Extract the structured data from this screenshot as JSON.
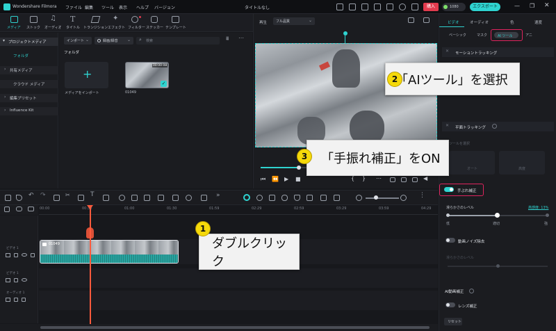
{
  "titlebar": {
    "app_name": "Wondershare Filmora",
    "menus": [
      "ファイル",
      "編集",
      "ツール",
      "表示",
      "ヘルプ",
      "バージョン"
    ],
    "doc_title": "タイトルなし",
    "buy_label": "購入",
    "points": "1080",
    "export_label": "エクスポート"
  },
  "toolbar_tabs": [
    "メディア",
    "ストック",
    "オーディオ",
    "タイトル",
    "トランジション",
    "エフェクト",
    "フィルター",
    "ステッカー",
    "テンプレート"
  ],
  "sidebar": {
    "items": [
      "プロジェクトメディア",
      "フォルダ",
      "共有メディア",
      "クラウド メディア",
      "編集プリセット",
      "Influence Kit"
    ]
  },
  "media": {
    "import_label": "インポート",
    "record_label": "録画/録音",
    "search_placeholder": "検索",
    "folder_label": "フォルダ",
    "import_tile_label": "メディアをインポート",
    "clip_name": "01049",
    "clip_duration": "00:00:08"
  },
  "player": {
    "play_label": "再生",
    "quality": "フル品質"
  },
  "right_panel": {
    "main_tabs": [
      "ビデオ",
      "オーディオ",
      "色",
      "速度"
    ],
    "sub_tabs": [
      "ベーシック",
      "マスク",
      "AI ツール",
      "アニ"
    ],
    "motion_tracking": "モーショントラッキング",
    "plane_tracking": "平面トラッキング",
    "auto_label": "オート",
    "enhanced_label": "高度",
    "auto_select_label": "ツールを選択",
    "stabilize_label": "手ぶれ補正",
    "smooth_label": "滑らかさのレベル",
    "smooth_value": "高感度: 13%",
    "slider_min": "低",
    "slider_mid": "適切",
    "slider_max": "強",
    "noise_label": "動画ノイズ除去",
    "noise_level_label": "滑らかさのレベル",
    "ai_correction_label": "AI動画補正",
    "lens_label": "レンズ補正",
    "reset_label": "リセット"
  },
  "timeline": {
    "ruler": [
      "00:00",
      "00:30",
      "01:00",
      "01:30",
      "01:59",
      "02:29",
      "02:59",
      "03:29",
      "03:59",
      "04:29"
    ],
    "tracks": [
      "ビデオ 1",
      "ビデオ 1",
      "オーディオ 1"
    ],
    "clip_label": "01049"
  },
  "callouts": {
    "c1_num": "1",
    "c1_text": "ダブルクリック",
    "c2_num": "2",
    "c2_text": "「AIツール」を選択",
    "c3_num": "3",
    "c3_text": "「手振れ補正」をON"
  },
  "colors": {
    "accent": "#2fd3d0",
    "callout_border": "#e0245e",
    "badge": "#f5d90a",
    "playhead": "#ff5a3c"
  }
}
